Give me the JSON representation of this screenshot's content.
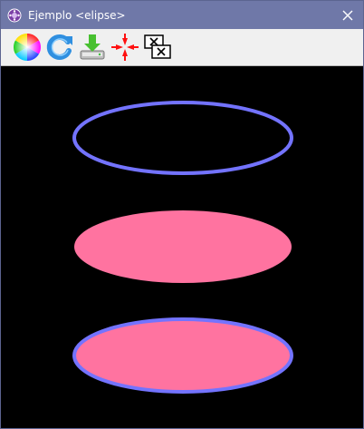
{
  "window": {
    "title": "Ejemplo <elipse>",
    "app_icon": "palette-app-icon",
    "close_icon": "close-icon"
  },
  "toolbar": {
    "items": [
      {
        "icon": "color-wheel-icon"
      },
      {
        "icon": "refresh-icon"
      },
      {
        "icon": "save-disk-icon"
      },
      {
        "icon": "center-arrows-icon"
      },
      {
        "icon": "close-windows-icon"
      }
    ]
  },
  "canvas": {
    "background": "#000000",
    "shapes": [
      {
        "kind": "ellipse-outline",
        "stroke": "#7373ff",
        "fill": "none"
      },
      {
        "kind": "ellipse-filled",
        "stroke": "none",
        "fill": "#ff73a0"
      },
      {
        "kind": "ellipse-filled-outlined",
        "stroke": "#7373ff",
        "fill": "#ff73a0"
      }
    ]
  }
}
